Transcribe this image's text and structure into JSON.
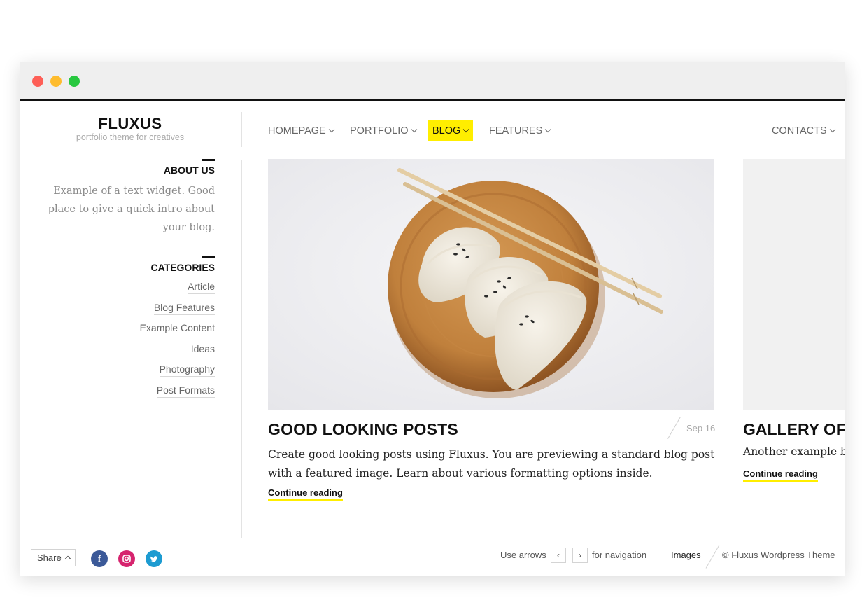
{
  "site": {
    "title": "FLUXUS",
    "tagline": "portfolio theme for creatives"
  },
  "nav": {
    "items": [
      {
        "label": "HOMEPAGE"
      },
      {
        "label": "PORTFOLIO"
      },
      {
        "label": "BLOG"
      },
      {
        "label": "FEATURES"
      },
      {
        "label": "CONTACTS"
      }
    ],
    "active_item": "BLOG"
  },
  "sidebar": {
    "about_title": "ABOUT US",
    "about_text": "Example of a text widget. Good place to give a quick intro about your blog.",
    "categories_title": "CATEGORIES",
    "categories": [
      "Article",
      "Blog Features",
      "Example Content",
      "Ideas",
      "Photography",
      "Post Formats"
    ]
  },
  "posts": [
    {
      "title": "GOOD LOOKING POSTS",
      "date": "Sep 16",
      "excerpt": "Create good looking posts using Fluxus. You are previewing a standard blog post with a featured image. Learn about various formatting options inside.",
      "more_label": "Continue reading"
    },
    {
      "title": "GALLERY OF",
      "excerpt": "Another example b",
      "more_label": "Continue reading"
    }
  ],
  "footer": {
    "share_label": "Share",
    "social_icons": [
      "facebook-icon",
      "instagram-icon",
      "twitter-icon"
    ],
    "nav_hint_prefix": "Use arrows",
    "nav_hint_suffix": "for navigation",
    "images_link": "Images",
    "copyright": "© Fluxus Wordpress Theme"
  },
  "colors": {
    "accent": "#ffee00",
    "facebook": "#3b5998",
    "instagram": "#d6246e",
    "twitter": "#1d9bd1",
    "traffic_red": "#fe5f57",
    "traffic_yellow": "#febc2e",
    "traffic_green": "#28c840"
  }
}
